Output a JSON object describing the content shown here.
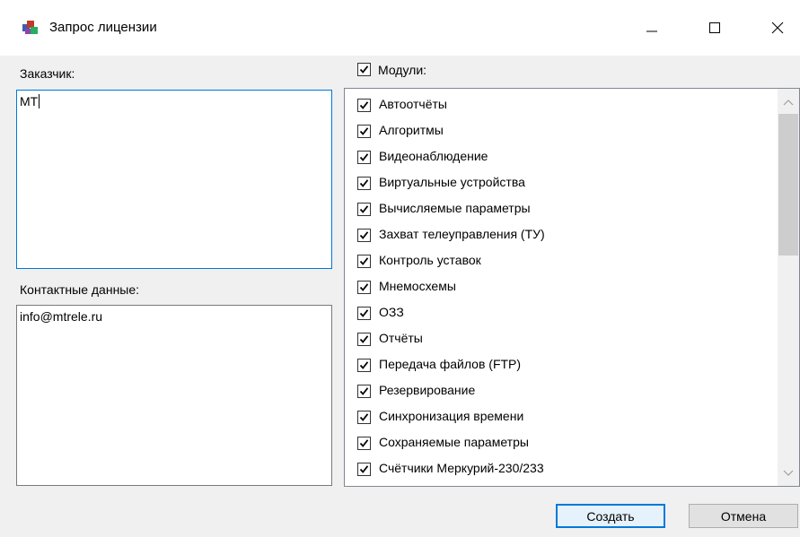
{
  "window": {
    "title": "Запрос лицензии"
  },
  "customer": {
    "label": "Заказчик:",
    "value": "МТ"
  },
  "contact": {
    "label": "Контактные данные:",
    "value": "info@mtrele.ru"
  },
  "modules": {
    "label": "Модули:",
    "checked": true,
    "items": [
      {
        "label": "Автоотчёты",
        "checked": true
      },
      {
        "label": "Алгоритмы",
        "checked": true
      },
      {
        "label": "Видеонаблюдение",
        "checked": true
      },
      {
        "label": "Виртуальные устройства",
        "checked": true
      },
      {
        "label": "Вычисляемые параметры",
        "checked": true
      },
      {
        "label": "Захват телеуправления (ТУ)",
        "checked": true
      },
      {
        "label": "Контроль уставок",
        "checked": true
      },
      {
        "label": "Мнемосхемы",
        "checked": true
      },
      {
        "label": "ОЗЗ",
        "checked": true
      },
      {
        "label": "Отчёты",
        "checked": true
      },
      {
        "label": "Передача файлов (FTP)",
        "checked": true
      },
      {
        "label": "Резервирование",
        "checked": true
      },
      {
        "label": "Синхронизация времени",
        "checked": true
      },
      {
        "label": "Сохраняемые параметры",
        "checked": true
      },
      {
        "label": "Счётчики Меркурий-230/233",
        "checked": true
      }
    ]
  },
  "buttons": {
    "create": "Создать",
    "cancel": "Отмена"
  }
}
